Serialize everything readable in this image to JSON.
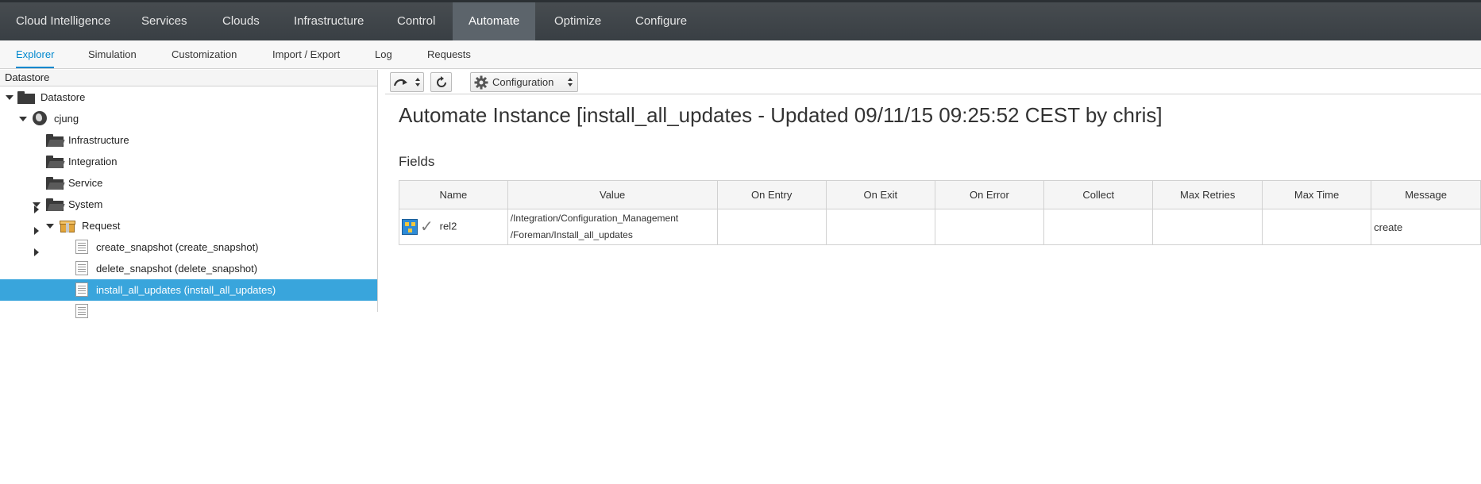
{
  "topnav": {
    "items": [
      "Cloud Intelligence",
      "Services",
      "Clouds",
      "Infrastructure",
      "Control",
      "Automate",
      "Optimize",
      "Configure"
    ],
    "active": "Automate"
  },
  "subnav": {
    "tabs": [
      "Explorer",
      "Simulation",
      "Customization",
      "Import / Export",
      "Log",
      "Requests"
    ],
    "active": "Explorer"
  },
  "tree": {
    "header": "Datastore",
    "nodes": [
      {
        "label": "Datastore",
        "icon": "folder-icon"
      },
      {
        "label": "cjung",
        "icon": "globe-icon"
      },
      {
        "label": "Infrastructure",
        "icon": "folder-open-icon"
      },
      {
        "label": "Integration",
        "icon": "folder-open-icon"
      },
      {
        "label": "Service",
        "icon": "folder-open-icon"
      },
      {
        "label": "System",
        "icon": "folder-open-icon"
      },
      {
        "label": "Request",
        "icon": "package-icon"
      },
      {
        "label": "create_snapshot (create_snapshot)",
        "icon": "instance-icon"
      },
      {
        "label": "delete_snapshot (delete_snapshot)",
        "icon": "instance-icon"
      },
      {
        "label": "install_all_updates (install_all_updates)",
        "icon": "instance-icon",
        "selected": true
      }
    ]
  },
  "toolbar": {
    "configuration_label": "Configuration"
  },
  "main": {
    "title": "Automate Instance [install_all_updates - Updated 09/11/15 09:25:52 CEST by chris]",
    "fields_heading": "Fields",
    "columns": [
      "Name",
      "Value",
      "On Entry",
      "On Exit",
      "On Error",
      "Collect",
      "Max Retries",
      "Max Time",
      "Message"
    ],
    "rows": [
      {
        "name": "rel2",
        "value_line1": "/Integration/Configuration_Management",
        "value_line2": "/Foreman/Install_all_updates",
        "on_entry": "",
        "on_exit": "",
        "on_error": "",
        "collect": "",
        "max_retries": "",
        "max_time": "",
        "message": "create"
      }
    ]
  },
  "colors": {
    "nav_bg": "#393f44",
    "nav_active": "#5c646b",
    "accent": "#0088ce",
    "selected_row": "#39a5dc"
  }
}
